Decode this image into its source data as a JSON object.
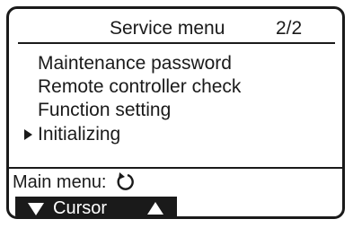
{
  "header": {
    "title": "Service menu",
    "page": "2/2"
  },
  "menu": {
    "items": [
      {
        "label": "Maintenance password",
        "selected": false
      },
      {
        "label": "Remote controller check",
        "selected": false
      },
      {
        "label": "Function setting",
        "selected": false
      },
      {
        "label": "Initializing",
        "selected": true
      }
    ]
  },
  "footer": {
    "main_menu_label": "Main menu:",
    "return_icon": "return-arrow-icon",
    "cursor_label": "Cursor"
  },
  "colors": {
    "foreground": "#1a1a1a",
    "background": "#ffffff"
  }
}
